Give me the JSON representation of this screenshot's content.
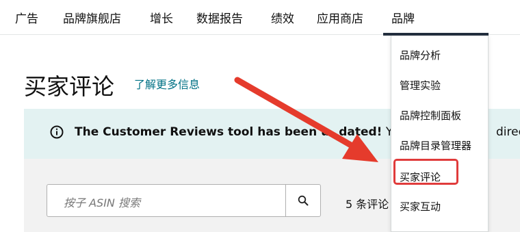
{
  "topnav": {
    "items": [
      "广告",
      "品牌旗舰店",
      "增长",
      "数据报告",
      "绩效",
      "应用商店",
      "品牌"
    ],
    "active": "品牌"
  },
  "page": {
    "title": "买家评论",
    "learn_more": "了解更多信息"
  },
  "banner": {
    "icon": "info-icon",
    "text_bold_1": "The Customer Reviews tool has been u",
    "text_bold_2": "dated!",
    "text_normal": " Yo",
    "text_tail": "direct"
  },
  "search": {
    "placeholder": "按子 ASIN 搜索",
    "button_icon": "search-icon"
  },
  "reviews": {
    "count_label": "5 条评论"
  },
  "dropdown": {
    "items": [
      "品牌分析",
      "管理实验",
      "品牌控制面板",
      "品牌目录管理器",
      "买家评论",
      "买家互动"
    ],
    "highlighted": "买家评论"
  },
  "colors": {
    "banner_bg": "#e3f2f2",
    "link": "#007185",
    "highlight": "#e03b3b",
    "active_bar": "#232f3e"
  }
}
